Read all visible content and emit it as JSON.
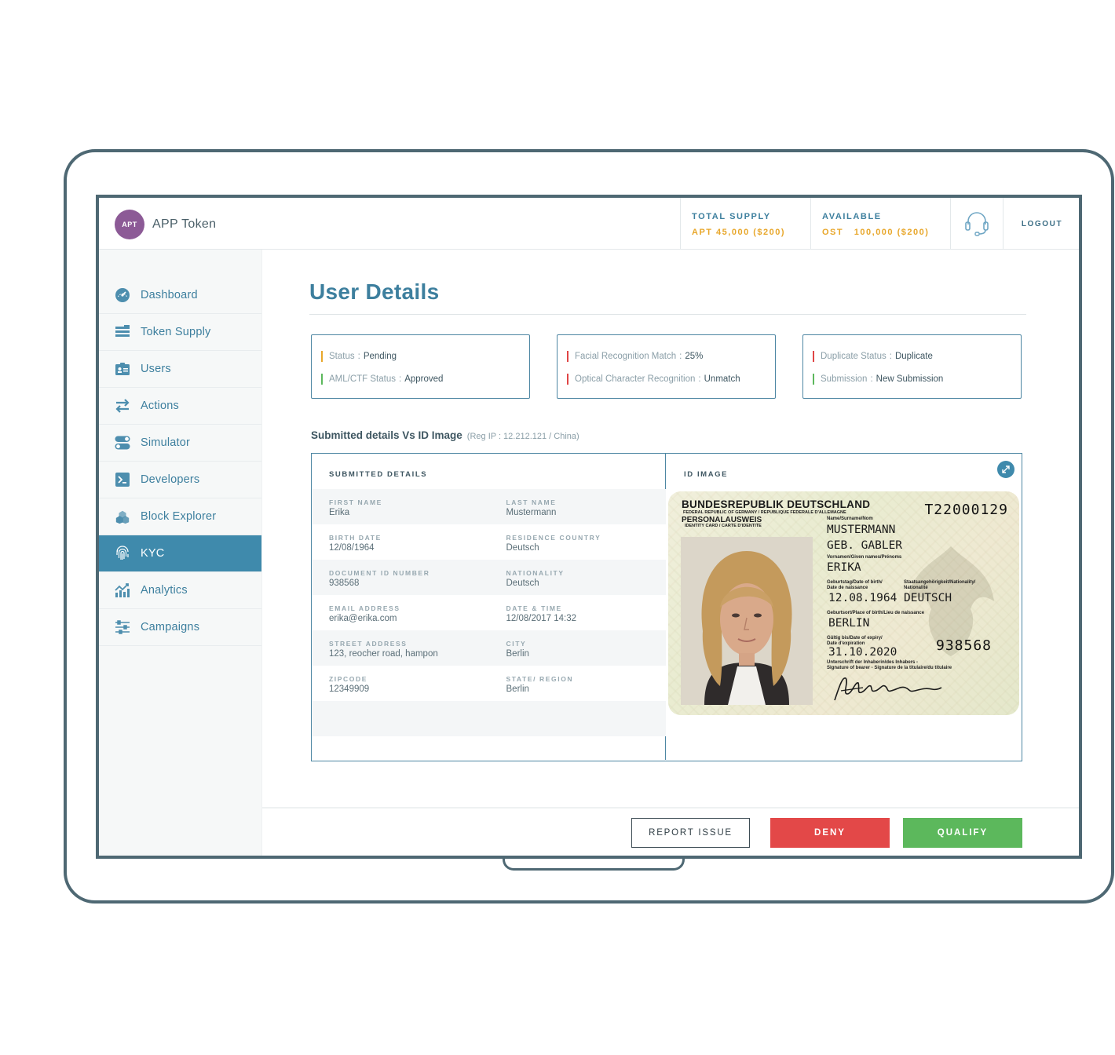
{
  "app": {
    "avatar_text": "APT",
    "name": "APP Token"
  },
  "header": {
    "total_supply": {
      "label": "TOTAL SUPPLY",
      "value": "APT 45,000 ($200)"
    },
    "available": {
      "label": "AVAILABLE",
      "value": "OST   100,000 ($200)"
    },
    "logout": "LOGOUT"
  },
  "sidebar": {
    "items": [
      {
        "label": "Dashboard",
        "icon": "dashboard-gauge-icon"
      },
      {
        "label": "Token Supply",
        "icon": "token-supply-icon"
      },
      {
        "label": "Users",
        "icon": "users-id-card-icon"
      },
      {
        "label": "Actions",
        "icon": "swap-arrows-icon"
      },
      {
        "label": "Simulator",
        "icon": "toggle-icon"
      },
      {
        "label": "Developers",
        "icon": "terminal-icon"
      },
      {
        "label": "Block Explorer",
        "icon": "blocks-icon"
      },
      {
        "label": "KYC",
        "icon": "fingerprint-icon",
        "active": true
      },
      {
        "label": "Analytics",
        "icon": "analytics-chart-icon"
      },
      {
        "label": "Campaigns",
        "icon": "sliders-icon"
      }
    ],
    "active_color": "#3f8aac"
  },
  "main": {
    "title": "User Details",
    "status_cards": [
      {
        "rows": [
          {
            "key": "Status",
            "value": "Pending",
            "color": "#e8a72b"
          },
          {
            "key": "AML/CTF Status",
            "value": "Approved",
            "color": "#5cb85c"
          }
        ]
      },
      {
        "rows": [
          {
            "key": "Facial Recognition Match",
            "value": "25%",
            "color": "#e04545"
          },
          {
            "key": "Optical Character Recognition",
            "value": "Unmatch",
            "color": "#e04545"
          }
        ]
      },
      {
        "rows": [
          {
            "key": "Duplicate Status",
            "value": "Duplicate",
            "color": "#e04545"
          },
          {
            "key": "Submission",
            "value": "New Submission",
            "color": "#5cb85c"
          }
        ]
      }
    ],
    "section": {
      "title": "Submitted details Vs ID Image",
      "reg_ip": "(Reg IP : 12.212.121 / China)"
    },
    "submitted_details": {
      "title": "SUBMITTED DETAILS",
      "fields": [
        [
          {
            "label": "FIRST NAME",
            "value": "Erika"
          },
          {
            "label": "LAST NAME",
            "value": "Mustermann"
          }
        ],
        [
          {
            "label": "BIRTH DATE",
            "value": "12/08/1964"
          },
          {
            "label": "RESIDENCE COUNTRY",
            "value": "Deutsch"
          }
        ],
        [
          {
            "label": "DOCUMENT ID NUMBER",
            "value": "938568"
          },
          {
            "label": "NATIONALITY",
            "value": "Deutsch"
          }
        ],
        [
          {
            "label": "EMAIL ADDRESS",
            "value": "erika@erika.com"
          },
          {
            "label": "DATE & TIME",
            "value": "12/08/2017  14:32"
          }
        ],
        [
          {
            "label": "STREET ADDRESS",
            "value": "123, reocher road, hampon"
          },
          {
            "label": "CITY",
            "value": "Berlin"
          }
        ],
        [
          {
            "label": "ZIPCODE",
            "value": "12349909"
          },
          {
            "label": "STATE/ REGION",
            "value": "Berlin"
          }
        ]
      ]
    },
    "id_image": {
      "title": "ID IMAGE",
      "card": {
        "country": "BUNDESREPUBLIK DEUTSCHLAND",
        "country_sub": "FEDERAL REPUBLIC OF GERMANY / REPUBLIQUE FEDERALE D'ALLEMAGNE",
        "doc_type": "PERSONALAUSWEIS",
        "doc_type_sub": "IDENTITY CARD / CARTE D'IDENTITE",
        "card_number": "T22000129",
        "surname_label": "Name/Surname/Nom",
        "surname": "MUSTERMANN",
        "birth_name": "GEB. GABLER",
        "given_label": "Vornamen/Given names/Prénoms",
        "given": "ERIKA",
        "dob_label": "Geburtstag/Date of birth/",
        "dob_label2": "Date de naissance",
        "nat_label": "Staatsangehörigkeit/Nationality/",
        "nat_label2": "Nationalité",
        "dob": "12.08.1964",
        "nationality": "DEUTSCH",
        "pob_label": "Geburtsort/Place of birth/Lieu de naissance",
        "pob": "BERLIN",
        "expiry_label": "Gültig bis/Date of expiry/",
        "expiry_label2": "Date d'expiration",
        "expiry": "31.10.2020",
        "doc_no": "938568",
        "sig_label": "Unterschrift der Inhaberin/des Inhabers -",
        "sig_label2": "Signature of bearer - Signature de la titulaire/du titulaire"
      }
    }
  },
  "actions": {
    "report": "REPORT ISSUE",
    "deny": "DENY",
    "qualify": "QUALIFY"
  }
}
